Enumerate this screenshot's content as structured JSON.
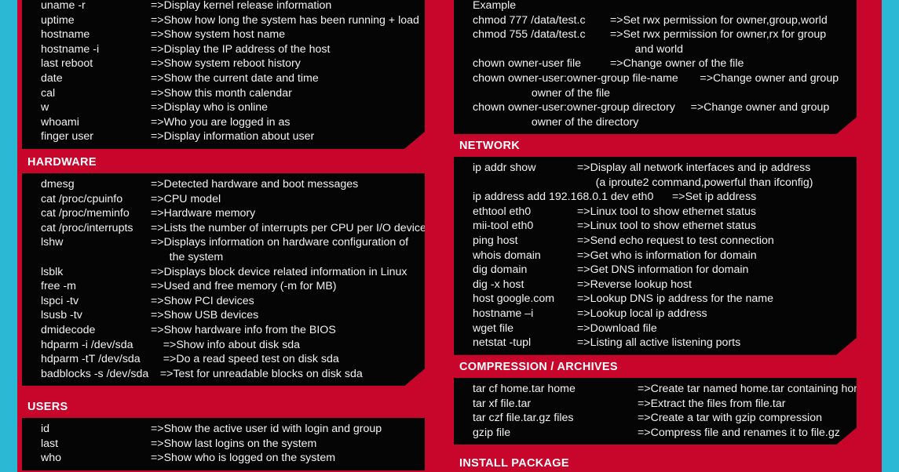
{
  "theme": {
    "background_red": "#c8062c",
    "accent_cyan": "#2bb8d4",
    "panel_black": "#050505",
    "text_white": "#f2f2f2"
  },
  "left_column": {
    "system_panel": {
      "rows": [
        {
          "cmd": "uname -r",
          "desc": "=>Display kernel release information"
        },
        {
          "cmd": "uptime",
          "desc": "=>Show how long the system has been running + load"
        },
        {
          "cmd": "hostname",
          "desc": "=>Show system host name"
        },
        {
          "cmd": "hostname -i",
          "desc": "=>Display the IP address of the host"
        },
        {
          "cmd": "last reboot",
          "desc": "=>Show system reboot history"
        },
        {
          "cmd": "date",
          "desc": "=>Show the current date and time"
        },
        {
          "cmd": "cal",
          "desc": "=>Show this month calendar"
        },
        {
          "cmd": "w",
          "desc": "=>Display who is online"
        },
        {
          "cmd": "whoami",
          "desc": "=>Who you are logged in as"
        },
        {
          "cmd": "finger user",
          "desc": "=>Display information about user"
        }
      ]
    },
    "hardware": {
      "header": "HARDWARE",
      "rows": [
        {
          "cmd": "dmesg",
          "desc": "=>Detected hardware and boot messages"
        },
        {
          "cmd": "cat /proc/cpuinfo",
          "desc": "=>CPU model"
        },
        {
          "cmd": "cat /proc/meminfo",
          "desc": "=>Hardware memory"
        },
        {
          "cmd": "cat /proc/interrupts",
          "desc": "=>Lists the number of interrupts per CPU per I/O device"
        },
        {
          "cmd": "lshw",
          "desc": "=>Displays information on hardware configuration of"
        },
        {
          "cmd": "",
          "desc": "      the system"
        },
        {
          "cmd": "lsblk",
          "desc": "=>Displays block device related information in Linux"
        },
        {
          "cmd": "free -m",
          "desc": "=>Used and free memory (-m for MB)"
        },
        {
          "cmd": "lspci -tv",
          "desc": "=>Show PCI devices"
        },
        {
          "cmd": "lsusb -tv",
          "desc": "=>Show USB devices"
        },
        {
          "cmd": "dmidecode",
          "desc": "=>Show hardware info from the BIOS"
        },
        {
          "cmd": "hdparm -i /dev/sda",
          "desc": "    =>Show info about disk sda"
        },
        {
          "cmd": "hdparm -tT /dev/sda",
          "desc": "    =>Do a read speed test on disk sda"
        },
        {
          "cmd": "badblocks -s /dev/sda",
          "desc": "   =>Test for unreadable blocks on disk sda"
        }
      ]
    },
    "users": {
      "header": "USERS",
      "rows": [
        {
          "cmd": "id",
          "desc": "=>Show the active user id with login and group"
        },
        {
          "cmd": "last",
          "desc": "=>Show last logins on the system"
        },
        {
          "cmd": "who",
          "desc": "=>Show who is logged on the system"
        }
      ]
    }
  },
  "right_column": {
    "example_panel": {
      "title": "Example",
      "rows": [
        {
          "cmd": "chmod 777 /data/test.c",
          "desc": "=>Set rwx permission for owner,group,world"
        },
        {
          "cmd": "chmod 755 /data/test.c",
          "desc": "=>Set rwx permission for owner,rx for group"
        },
        {
          "cmd": "",
          "desc": "        and world"
        },
        {
          "cmd": "chown owner-user file",
          "desc": "=>Change owner of the file"
        },
        {
          "cmd": "chown owner-user:owner-group file-name",
          "desc": "       =>Change owner and group"
        },
        {
          "cmd": "",
          "desc": "                   owner of the file"
        },
        {
          "cmd": "chown owner-user:owner-group directory",
          "desc": "     =>Change owner and group"
        },
        {
          "cmd": "",
          "desc": "                   owner of the directory"
        }
      ]
    },
    "network": {
      "header": "NETWORK",
      "rows": [
        {
          "cmd": "ip addr show",
          "desc": "=>Display all network interfaces and ip address"
        },
        {
          "cmd": "",
          "desc": "      (a iproute2 command,powerful than ifconfig)"
        },
        {
          "cmd": "ip address add 192.168.0.1 dev eth0",
          "desc": "      =>Set ip address"
        },
        {
          "cmd": "ethtool eth0",
          "desc": "=>Linux tool to show ethernet status"
        },
        {
          "cmd": "mii-tool eth0",
          "desc": "=>Linux tool to show ethernet status"
        },
        {
          "cmd": "ping host",
          "desc": "=>Send echo request to test connection"
        },
        {
          "cmd": "whois domain",
          "desc": "=>Get who is information for domain"
        },
        {
          "cmd": "dig domain",
          "desc": "=>Get DNS information for domain"
        },
        {
          "cmd": "dig -x host",
          "desc": "=>Reverse lookup host"
        },
        {
          "cmd": "host google.com",
          "desc": "=>Lookup DNS ip address for the name"
        },
        {
          "cmd": "hostname –i",
          "desc": "=>Lookup local ip address"
        },
        {
          "cmd": "wget file",
          "desc": "=>Download file"
        },
        {
          "cmd": "netstat -tupl",
          "desc": "=>Listing all active listening ports"
        }
      ]
    },
    "compression": {
      "header": "COMPRESSION / ARCHIVES",
      "rows": [
        {
          "cmd": "tar cf home.tar home",
          "desc": "=>Create tar named home.tar containing home/"
        },
        {
          "cmd": "tar xf file.tar",
          "desc": "=>Extract the files from file.tar"
        },
        {
          "cmd": "tar czf file.tar.gz files",
          "desc": "=>Create a tar with gzip compression"
        },
        {
          "cmd": "gzip file",
          "desc": "=>Compress file and renames it to file.gz"
        }
      ]
    },
    "install_package": {
      "header": "INSTALL PACKAGE"
    }
  }
}
